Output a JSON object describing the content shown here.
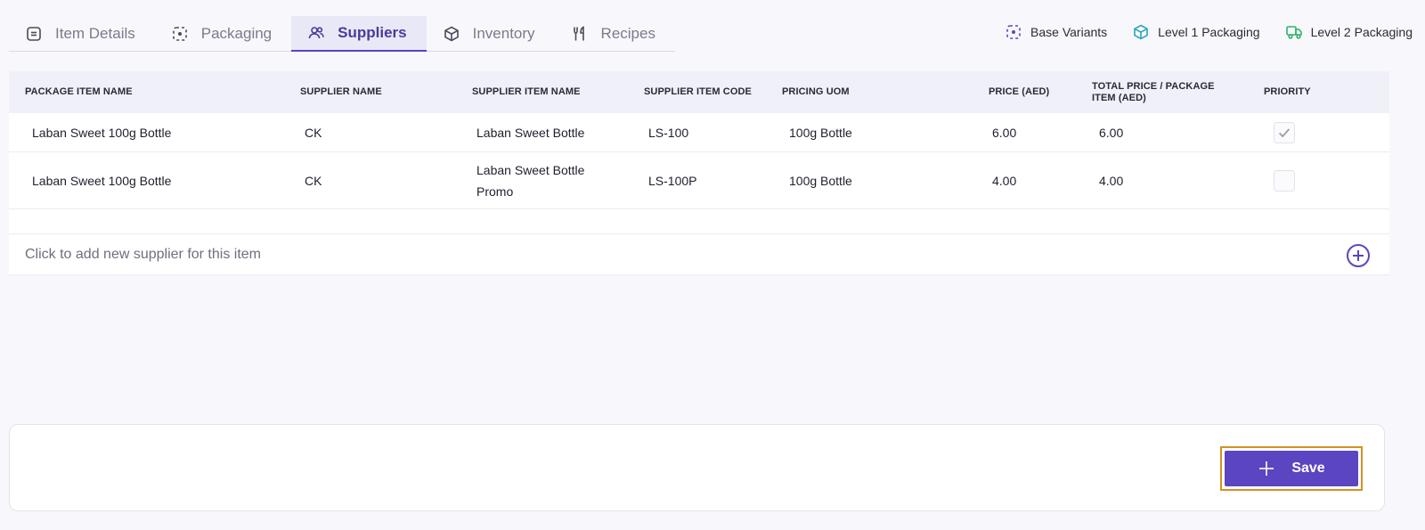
{
  "tabs": [
    {
      "label": "Item Details",
      "icon": "doc-icon",
      "active": false
    },
    {
      "label": "Packaging",
      "icon": "dashed-box-icon",
      "active": false
    },
    {
      "label": "Suppliers",
      "icon": "users-icon",
      "active": true
    },
    {
      "label": "Inventory",
      "icon": "cube-icon",
      "active": false
    },
    {
      "label": "Recipes",
      "icon": "fork-knife-icon",
      "active": false
    }
  ],
  "legend": [
    {
      "label": "Base Variants",
      "icon": "dashed-box-icon",
      "color": "#5b45c0"
    },
    {
      "label": "Level 1 Packaging",
      "icon": "cube-icon",
      "color": "#2aa6b8"
    },
    {
      "label": "Level 2 Packaging",
      "icon": "truck-icon",
      "color": "#2fb36a"
    }
  ],
  "table": {
    "headers": {
      "package_item_name": "PACKAGE ITEM NAME",
      "supplier_name": "SUPPLIER NAME",
      "supplier_item_name": "SUPPLIER ITEM NAME",
      "supplier_item_code": "SUPPLIER ITEM CODE",
      "pricing_uom": "PRICING UOM",
      "price": "PRICE (AED)",
      "total_price": "TOTAL PRICE / PACKAGE ITEM (AED)",
      "priority": "PRIORITY"
    },
    "rows": [
      {
        "package_item_name": "Laban Sweet 100g Bottle",
        "supplier_name": "CK",
        "supplier_item_name": "Laban Sweet Bottle",
        "supplier_item_code": "LS-100",
        "pricing_uom": "100g Bottle",
        "price": "6.00",
        "total_price": "6.00",
        "priority": true
      },
      {
        "package_item_name": "Laban Sweet 100g Bottle",
        "supplier_name": "CK",
        "supplier_item_name": "Laban Sweet Bottle Promo",
        "supplier_item_code": "LS-100P",
        "pricing_uom": "100g Bottle",
        "price": "4.00",
        "total_price": "4.00",
        "priority": false
      }
    ]
  },
  "add_supplier_text": "Click to add new supplier for this item",
  "save_label": "Save",
  "colors": {
    "accent": "#5b45c0",
    "highlight": "#d4921f"
  }
}
